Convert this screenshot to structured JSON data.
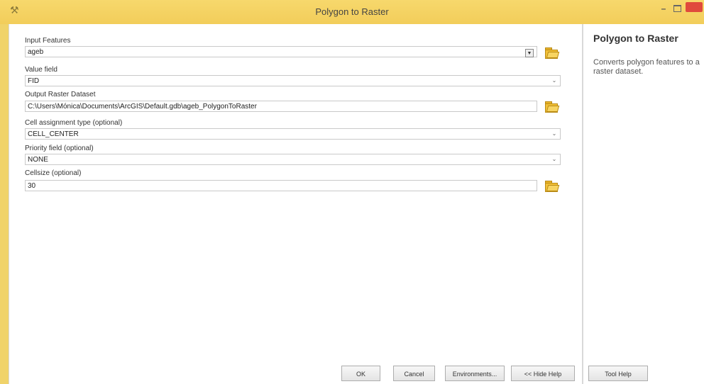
{
  "window": {
    "title": "Polygon to Raster"
  },
  "form": {
    "input_features_label": "Input Features",
    "input_features_value": "ageb",
    "value_field_label": "Value field",
    "value_field_value": "FID",
    "output_raster_label": "Output Raster Dataset",
    "output_raster_value": "C:\\Users\\Mónica\\Documents\\ArcGIS\\Default.gdb\\ageb_PolygonToRaster",
    "cell_assignment_label": "Cell assignment type (optional)",
    "cell_assignment_value": "CELL_CENTER",
    "priority_field_label": "Priority field (optional)",
    "priority_field_value": "NONE",
    "cellsize_label": "Cellsize (optional)",
    "cellsize_value": "30"
  },
  "help": {
    "title": "Polygon to Raster",
    "description": "Converts polygon features to a raster dataset."
  },
  "buttons": {
    "ok": "OK",
    "cancel": "Cancel",
    "environments": "Environments...",
    "hide_help": "<< Hide Help",
    "tool_help": "Tool Help"
  },
  "icons": {
    "app": "hammer-icon",
    "browse": "folder-open-icon"
  }
}
